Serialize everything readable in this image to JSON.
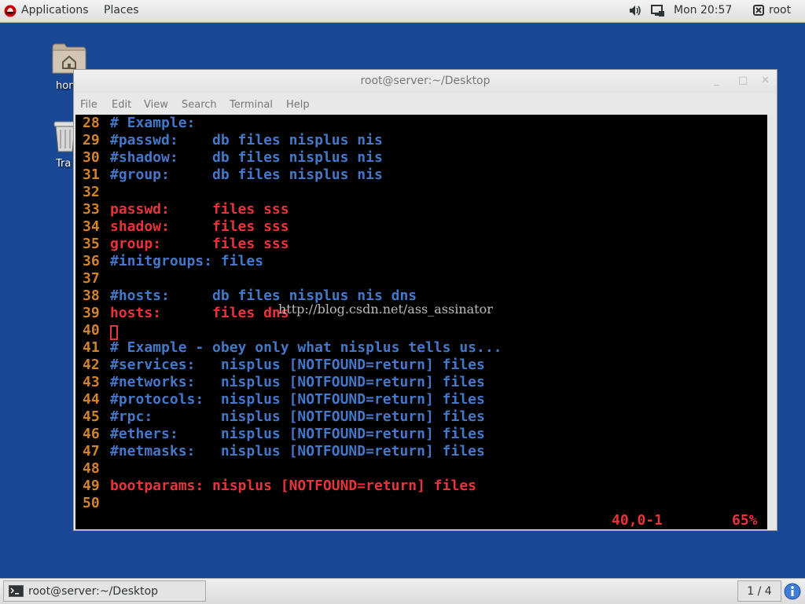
{
  "top_panel": {
    "applications": "Applications",
    "places": "Places",
    "clock": "Mon 20:57",
    "user": "root"
  },
  "desktop": {
    "home_label": "hon",
    "trash_label": "Tra"
  },
  "window": {
    "title": "root@server:~/Desktop",
    "menu": [
      "File",
      "Edit",
      "View",
      "Search",
      "Terminal",
      "Help"
    ]
  },
  "terminal": {
    "lines": [
      {
        "num": "28",
        "text": "# Example:",
        "color": "blue"
      },
      {
        "num": "29",
        "text": "#passwd:    db files nisplus nis",
        "color": "blue"
      },
      {
        "num": "30",
        "text": "#shadow:    db files nisplus nis",
        "color": "blue"
      },
      {
        "num": "31",
        "text": "#group:     db files nisplus nis",
        "color": "blue"
      },
      {
        "num": "32",
        "text": "",
        "color": "blue"
      },
      {
        "num": "33",
        "text": "passwd:     files sss",
        "color": "red"
      },
      {
        "num": "34",
        "text": "shadow:     files sss",
        "color": "red"
      },
      {
        "num": "35",
        "text": "group:      files sss",
        "color": "red"
      },
      {
        "num": "36",
        "text": "#initgroups: files",
        "color": "blue"
      },
      {
        "num": "37",
        "text": "",
        "color": "blue"
      },
      {
        "num": "38",
        "text": "#hosts:     db files nisplus nis dns",
        "color": "blue"
      },
      {
        "num": "39",
        "text": "hosts:      files dns",
        "color": "red"
      },
      {
        "num": "40",
        "text": "",
        "color": "blue"
      },
      {
        "num": "41",
        "text": "# Example - obey only what nisplus tells us...",
        "color": "blue"
      },
      {
        "num": "42",
        "text": "#services:   nisplus [NOTFOUND=return] files",
        "color": "blue"
      },
      {
        "num": "43",
        "text": "#networks:   nisplus [NOTFOUND=return] files",
        "color": "blue"
      },
      {
        "num": "44",
        "text": "#protocols:  nisplus [NOTFOUND=return] files",
        "color": "blue"
      },
      {
        "num": "45",
        "text": "#rpc:        nisplus [NOTFOUND=return] files",
        "color": "blue"
      },
      {
        "num": "46",
        "text": "#ethers:     nisplus [NOTFOUND=return] files",
        "color": "blue"
      },
      {
        "num": "47",
        "text": "#netmasks:   nisplus [NOTFOUND=return] files",
        "color": "blue"
      },
      {
        "num": "48",
        "text": "",
        "color": "blue"
      },
      {
        "num": "49",
        "text": "bootparams: nisplus [NOTFOUND=return] files",
        "color": "red"
      },
      {
        "num": "50",
        "text": "",
        "color": "blue"
      }
    ],
    "watermark": "http://blog.csdn.net/ass_assinator",
    "status_position": "40,0-1",
    "status_percent": "65%"
  },
  "taskbar": {
    "task_label": "root@server:~/Desktop",
    "workspace": "1 / 4"
  },
  "colors": {
    "desktop_bg": "#1b4894",
    "term_blue": "#4577c9",
    "term_red": "#e8333a",
    "line_number": "#d0832a"
  },
  "icons": [
    "redhat-logo-icon",
    "volume-icon",
    "display-icon",
    "user-icon",
    "home-folder-icon",
    "trash-icon",
    "terminal-icon",
    "info-icon"
  ]
}
